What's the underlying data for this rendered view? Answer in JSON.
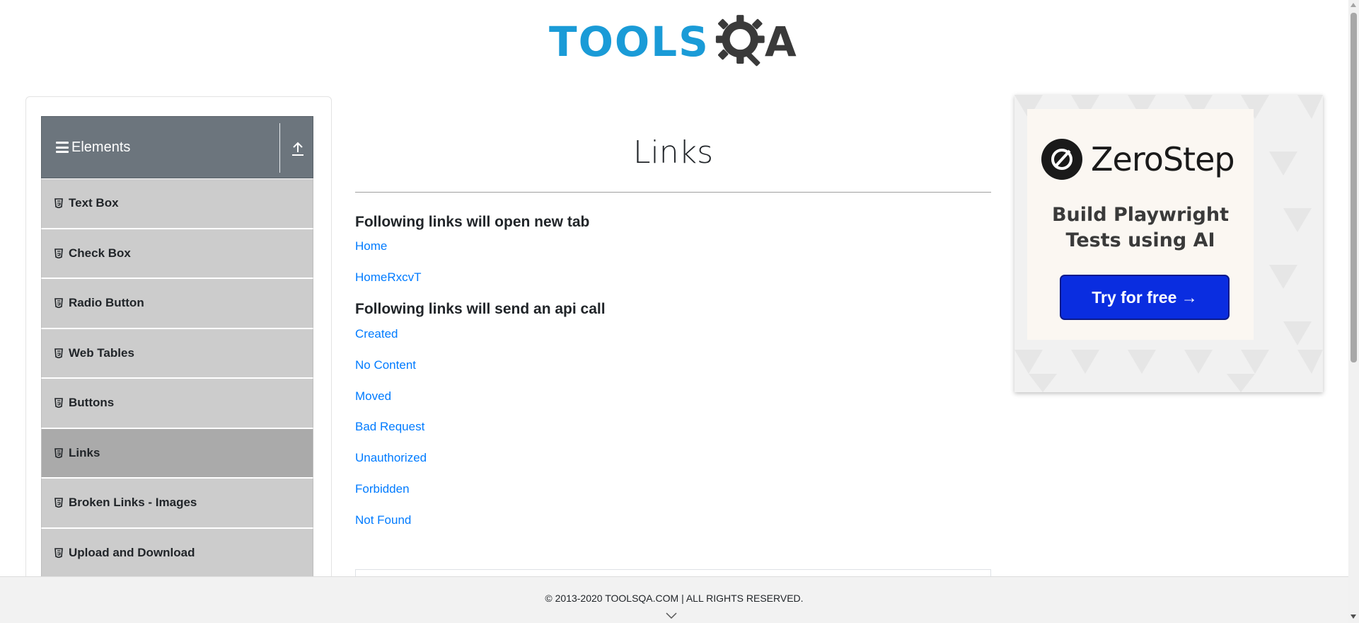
{
  "header": {
    "logo_text": "TOOLSQA",
    "logo_icon": "gear-magnifier-icon"
  },
  "sidebar": {
    "group_title": "Elements",
    "group_icon": "hamburger-icon",
    "collapse_icon": "upload-arrow-icon",
    "items": [
      {
        "label": "Text Box",
        "active": false
      },
      {
        "label": "Check Box",
        "active": false
      },
      {
        "label": "Radio Button",
        "active": false
      },
      {
        "label": "Web Tables",
        "active": false
      },
      {
        "label": "Buttons",
        "active": false
      },
      {
        "label": "Links",
        "active": true
      },
      {
        "label": "Broken Links - Images",
        "active": false
      },
      {
        "label": "Upload and Download",
        "active": false
      }
    ]
  },
  "main": {
    "title": "Links",
    "new_tab_heading": "Following links will open new tab",
    "new_tab_links": [
      "Home",
      "HomeRxcvT"
    ],
    "api_heading": "Following links will send an api call",
    "api_links": [
      "Created",
      "No Content",
      "Moved",
      "Bad Request",
      "Unauthorized",
      "Forbidden",
      "Not Found"
    ]
  },
  "ad": {
    "brand": "ZeroStep",
    "tagline_line1": "Build Playwright",
    "tagline_line2": "Tests using AI",
    "cta": "Try for free →"
  },
  "footer": {
    "copyright": "© 2013-2020 TOOLSQA.COM | ALL RIGHTS RESERVED."
  },
  "colors": {
    "link": "#007bff",
    "sidebar_header": "#6c757d",
    "menu_item": "#cccccc",
    "menu_item_active": "#aaaaaa",
    "logo_blue": "#1a9bd7",
    "cta_blue": "#0a2de0"
  }
}
